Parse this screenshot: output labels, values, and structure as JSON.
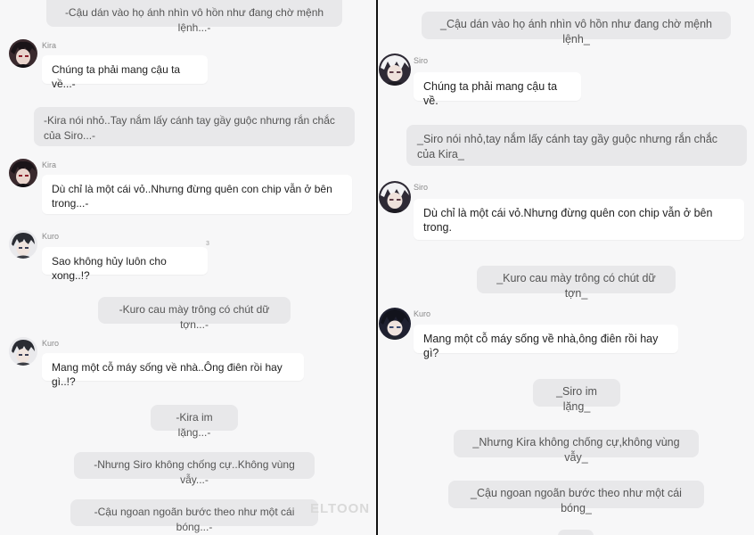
{
  "left": {
    "narration": [
      "-Cậu dán vào họ ánh nhìn vô hồn như đang chờ mệnh lệnh...-",
      "-Kira nói nhỏ..Tay nắm lấy cánh tay gầy guộc nhưng rắn chắc của Siro...-",
      "-Kuro cau mày trông có chút dữ tợn...-",
      "-Kira im lặng...-",
      "-Nhưng Siro không chống cự..Không vùng vẫy...-",
      "-Cậu ngoan ngoãn bước theo như một cái bóng...-"
    ],
    "messages": [
      {
        "name": "Kira",
        "text": "Chúng ta phải mang cậu ta về...-",
        "avatar": "kira-avatar"
      },
      {
        "name": "Kira",
        "text": "Dù chỉ là một cái vỏ..Nhưng đừng quên con chip vẫn ở bên trong...-",
        "avatar": "kira-avatar"
      },
      {
        "name": "Kuro",
        "text": "Sao không hủy luôn cho xong..!?",
        "avatar": "kuro-avatar"
      },
      {
        "name": "Kuro",
        "text": "Mang một cỗ máy sống về nhà..Ông điên rồi hay gì..!?",
        "avatar": "kuro-avatar"
      }
    ],
    "tiny_mark": "3",
    "watermark": "ELTOON"
  },
  "right": {
    "narration": [
      "_Cậu dán vào họ ánh nhìn vô hồn như đang chờ mệnh lệnh_",
      "_Siro nói nhỏ,tay nắm lấy cánh tay gầy guộc nhưng rắn chắc của Kira_",
      "_Kuro cau mày trông có chút dữ tợn_",
      "_Siro im lặng_",
      "_Nhưng Kira không chống cự,không vùng vẫy_",
      "_Cậu ngoan ngoãn bước theo như một cái bóng_"
    ],
    "messages": [
      {
        "name": "Siro",
        "text": "Chúng ta phải mang cậu ta về.",
        "avatar": "siro-avatar"
      },
      {
        "name": "Siro",
        "text": "Dù chỉ là một cái vỏ.Nhưng đừng quên con chip vẫn ở bên trong.",
        "avatar": "siro-avatar"
      },
      {
        "name": "Kuro",
        "text": "Mang một cỗ máy sống về nhà,ông điên rồi hay gì?",
        "avatar": "kuro-avatar"
      }
    ]
  },
  "colors": {
    "background": "#f7f7f8",
    "narration_bg": "#e8e8ea",
    "bubble_bg": "#ffffff",
    "divider": "#111111"
  }
}
